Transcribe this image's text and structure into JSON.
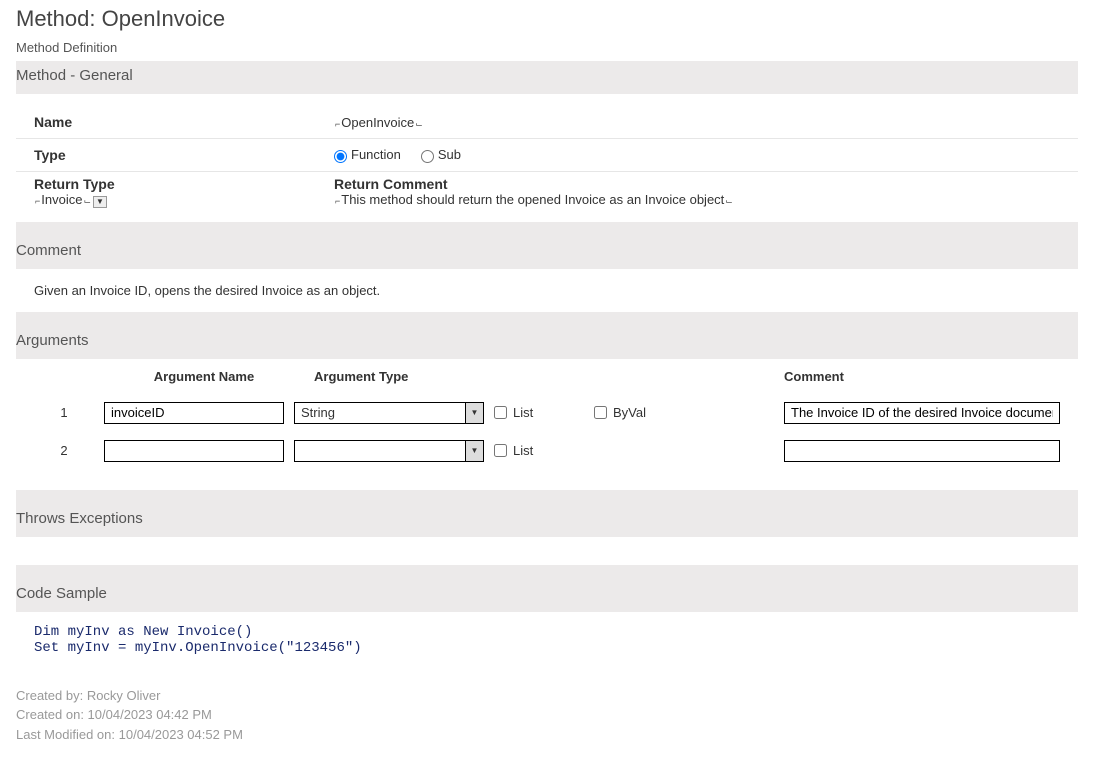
{
  "title": "Method: OpenInvoice",
  "subheading": "Method Definition",
  "sections": {
    "general": "Method - General",
    "comment": "Comment",
    "arguments": "Arguments",
    "throws": "Throws Exceptions",
    "code": "Code Sample"
  },
  "general": {
    "name_label": "Name",
    "name_value": "OpenInvoice",
    "type_label": "Type",
    "type_function": "Function",
    "type_sub": "Sub",
    "return_type_label": "Return Type",
    "return_type_value": "Invoice",
    "return_comment_label": "Return Comment",
    "return_comment_value": "This method should return the opened Invoice as an Invoice object"
  },
  "comment_text": "Given an Invoice ID, opens the desired Invoice as an object.",
  "args_headers": {
    "name": "Argument Name",
    "type": "Argument Type",
    "comment": "Comment"
  },
  "check_labels": {
    "list": "List",
    "byval": "ByVal"
  },
  "arguments": [
    {
      "num": "1",
      "name": "invoiceID",
      "type": "String",
      "list": false,
      "byval": false,
      "comment": "The Invoice ID of the desired Invoice document"
    },
    {
      "num": "2",
      "name": "",
      "type": "",
      "list": false,
      "byval": null,
      "comment": ""
    }
  ],
  "code_sample": "Dim myInv as New Invoice()\nSet myInv = myInv.OpenInvoice(\"123456\")",
  "meta": {
    "created_by": "Created by: Rocky Oliver",
    "created_on": "Created on: 10/04/2023 04:42 PM",
    "modified_on": "Last Modified on: 10/04/2023 04:52 PM"
  }
}
